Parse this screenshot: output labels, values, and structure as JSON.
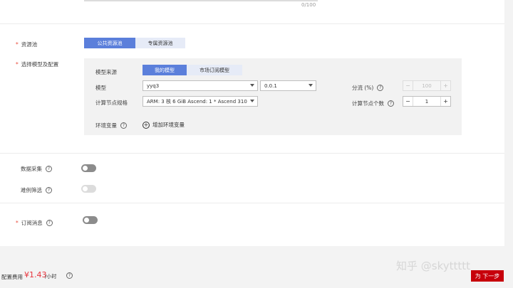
{
  "counter": "0/100",
  "resource_pool": {
    "label": "资源池",
    "options": [
      "公共资源池",
      "专属资源池"
    ],
    "selected": 0
  },
  "model_config": {
    "label": "选择模型及配置",
    "source_label": "模型来源",
    "source_options": [
      "我的模型",
      "市场订阅模型"
    ],
    "model_label": "模型",
    "model_value": "yyq3",
    "version_value": "0.0.1",
    "spec_label": "计算节点规格",
    "spec_value": "ARM: 3 核 6 GiB Ascend: 1 * Ascend 310",
    "traffic_label": "分流 (%)",
    "traffic_value": "100",
    "node_count_label": "计算节点个数",
    "node_count_value": "1",
    "env_label": "环境变量",
    "add_env_label": "增加环境变量"
  },
  "data_collection_label": "数据采集",
  "hard_example_label": "难例筛选",
  "subscribe_label": "订阅消息",
  "footer": {
    "fee_label": "配置费用",
    "price": "¥1.43",
    "unit": "/小时",
    "next_label": "为 下一步"
  },
  "watermark": "知乎 @skyttttt",
  "colors": {
    "primary": "#5b7fdb",
    "required": "#e84c3d",
    "price": "#e8333c",
    "next_button": "#c7000b"
  }
}
